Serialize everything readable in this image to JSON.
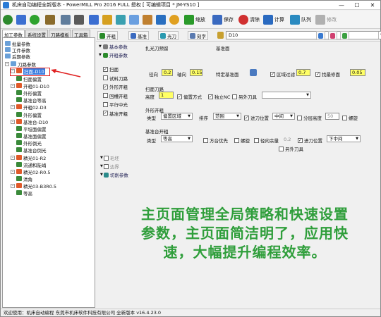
{
  "window": {
    "title": "机床自动编程全新版本 - PowerMILL Pro 2016 FULL 授权   [ 可编辑项目 * JM-YS10 ]"
  },
  "toolbar": {
    "simulate_label": "缩放",
    "save_label": "保存",
    "clear_label": "清除",
    "calc_label": "计算",
    "queue_label": "队列",
    "modify_label": "修改"
  },
  "left_tabs": [
    "加工参数",
    "系统设置",
    "刀路模板",
    "工具箱"
  ],
  "tree": [
    {
      "label": "批量参数",
      "indent": 0,
      "icon": "#6aa0d8"
    },
    {
      "label": "工件参数",
      "indent": 0,
      "icon": "#6aa0d8"
    },
    {
      "label": "后期参数",
      "indent": 0,
      "icon": "#6aa0d8"
    },
    {
      "label": "刀路参数",
      "indent": 0,
      "icon": "#6aa0d8",
      "exp": "-"
    },
    {
      "label": "扫面-D10",
      "indent": 1,
      "icon": "#e05a2a",
      "exp": "-",
      "selected": true
    },
    {
      "label": "扫面偏置",
      "indent": 2,
      "icon": "#3a8a3a"
    },
    {
      "label": "开粗01-D10",
      "indent": 1,
      "icon": "#e05a2a",
      "exp": "-"
    },
    {
      "label": "外形偏置",
      "indent": 2,
      "icon": "#3a8a3a"
    },
    {
      "label": "基准台等高",
      "indent": 2,
      "icon": "#3a8a3a"
    },
    {
      "label": "开粗02-D3",
      "indent": 1,
      "icon": "#e05a2a",
      "exp": "-"
    },
    {
      "label": "外形偏置",
      "indent": 2,
      "icon": "#3a8a3a"
    },
    {
      "label": "基准台-D10",
      "indent": 1,
      "icon": "#e05a2a",
      "exp": "-"
    },
    {
      "label": "平坦面偏置",
      "indent": 2,
      "icon": "#3a8a3a"
    },
    {
      "label": "基准面偏置",
      "indent": 2,
      "icon": "#3a8a3a"
    },
    {
      "label": "外形倒光",
      "indent": 2,
      "icon": "#3a8a3a"
    },
    {
      "label": "基准台倒光",
      "indent": 2,
      "icon": "#3a8a3a"
    },
    {
      "label": "精光01-R2",
      "indent": 1,
      "icon": "#e05a2a",
      "exp": "-"
    },
    {
      "label": "流通和陡峭",
      "indent": 2,
      "icon": "#3a8a3a"
    },
    {
      "label": "精光02-R0.5",
      "indent": 1,
      "icon": "#e05a2a",
      "exp": "-"
    },
    {
      "label": "清角",
      "indent": 2,
      "icon": "#3a8a3a"
    },
    {
      "label": "精光03-B3R0.5",
      "indent": 1,
      "icon": "#e05a2a",
      "exp": "-"
    },
    {
      "label": "等高",
      "indent": 2,
      "icon": "#3a8a3a"
    }
  ],
  "panel": {
    "btn_open": "开粗",
    "btn_base": "基准",
    "btn_light": "光刀",
    "btn_angle": "刻字",
    "tool_combo": "D10",
    "basic_params": "基本参数",
    "open_params": "开粗参数",
    "side_items": [
      "扫面",
      "试料刀路",
      "外形开粗",
      "回槽开粗",
      "平行中光",
      "基准开粗"
    ],
    "side_checked": [
      true,
      false,
      true,
      false,
      false,
      true
    ],
    "bottom_side": [
      "毛坯",
      "边界",
      "切削参数"
    ],
    "light_group": "扎光刀预留",
    "radial_label": "径向",
    "radial_val": "0.2",
    "axial_label": "轴向",
    "axial_val": "0.15",
    "base_face": "基准面",
    "special_face": "特定基准面",
    "region_filter": "区域过滤",
    "region_val": "0.7",
    "clip_label": "找最修面",
    "clip_val": "0.05",
    "scan_face": "扫面刀路",
    "height_label": "高度",
    "height_val": "1",
    "offset_mode": "偏置方式",
    "alone_nc": "独立NC",
    "other_tool": "另外刀具",
    "outer_open": "外形开粗",
    "type_label": "类型",
    "type_val": "偏置区域",
    "order_label": "排序",
    "order_val": "范围",
    "feed_pos": "进刀位置",
    "feed_val": "中间",
    "layer_h": "分层高度",
    "layer_val": "50",
    "spiral": "螺旋",
    "base_open": "基准台开粗",
    "type2_val": "等高",
    "dir_first": "方台优先",
    "spiral2": "螺旋",
    "radial_margin": "径向余量",
    "radial_margin_val": "0.2",
    "feed_pos2": "进刀位置",
    "feed_val2": "下中间",
    "other_tool2": "另外刀具"
  },
  "banner": "主页面管理全局策略和快速设置参数，主页面简洁明了，应用快速，大幅提升编程效率。",
  "status": "欢迎使用：机床自动编程 东莞市机床软件科技有限公司 全新版本 v16.4.23.0"
}
